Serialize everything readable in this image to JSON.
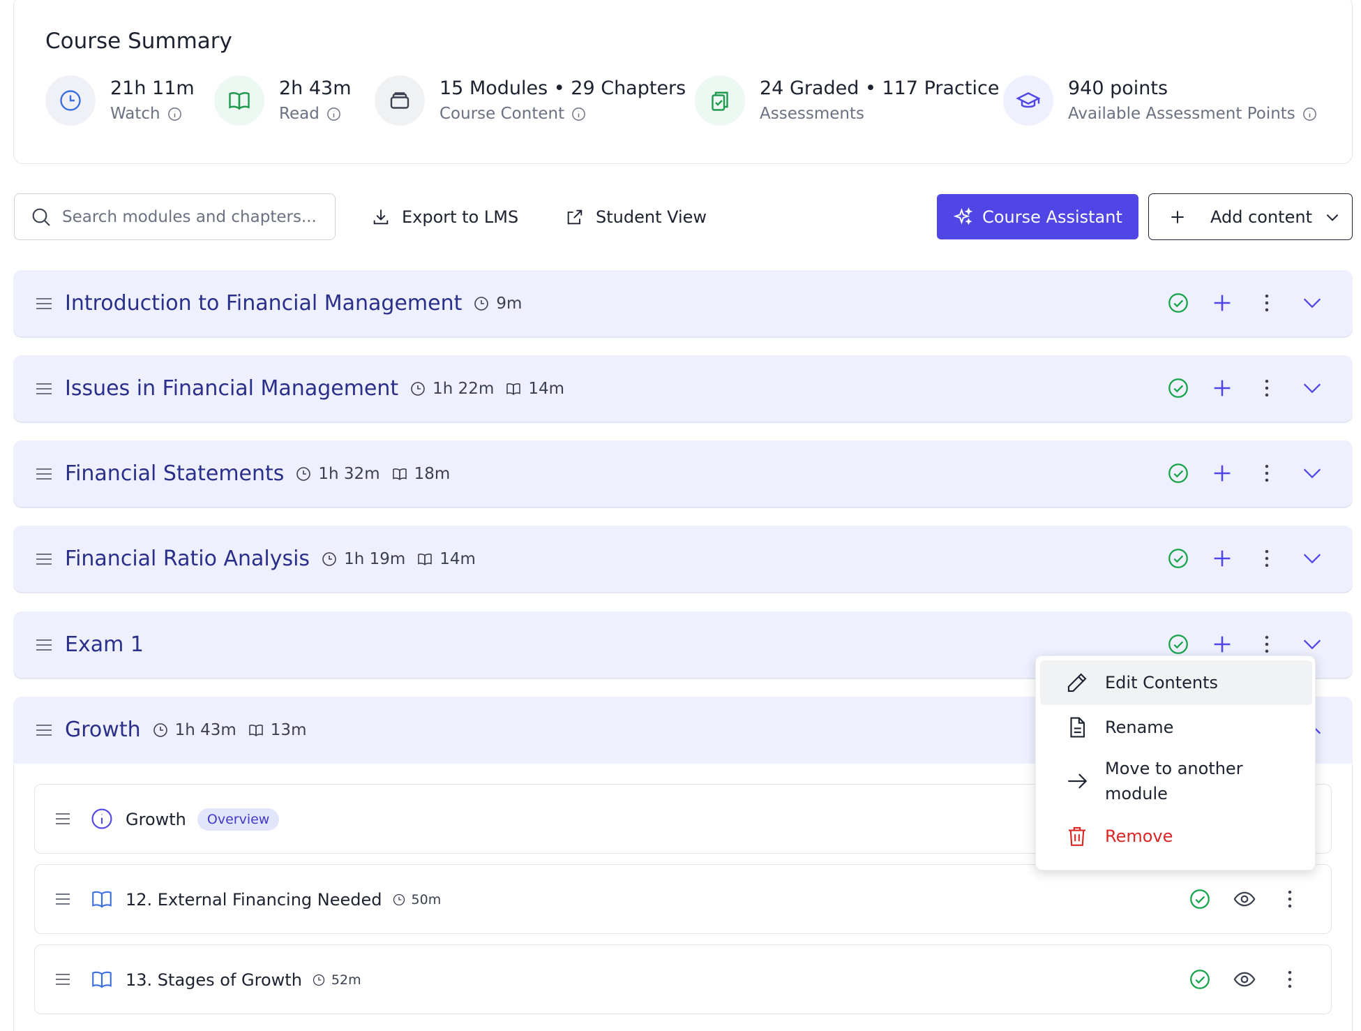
{
  "summary": {
    "title": "Course Summary",
    "stats": [
      {
        "value": "21h 11m",
        "label": "Watch",
        "icon": "clock-icon",
        "info": true
      },
      {
        "value": "2h 43m",
        "label": "Read",
        "icon": "book-icon",
        "info": true
      },
      {
        "value": "15 Modules • 29 Chapters",
        "label": "Course Content",
        "icon": "layers-icon",
        "info": true
      },
      {
        "value": "24 Graded • 117 Practice",
        "label": "Assessments",
        "icon": "clipboard-check-icon",
        "info": false
      },
      {
        "value": "940 points",
        "label": "Available Assessment Points",
        "icon": "graduation-cap-icon",
        "info": true
      }
    ]
  },
  "toolbar": {
    "search_placeholder": "Search modules and chapters...",
    "export_label": "Export to LMS",
    "student_view_label": "Student View",
    "assistant_label": "Course Assistant",
    "add_content_label": "Add content"
  },
  "modules": [
    {
      "title": "Introduction to Financial Management",
      "watch": "9m",
      "read": ""
    },
    {
      "title": "Issues in Financial Management",
      "watch": "1h 22m",
      "read": "14m"
    },
    {
      "title": "Financial Statements",
      "watch": "1h 32m",
      "read": "18m"
    },
    {
      "title": "Financial Ratio Analysis",
      "watch": "1h 19m",
      "read": "14m"
    },
    {
      "title": "Exam 1",
      "watch": "",
      "read": ""
    },
    {
      "title": "Growth",
      "watch": "1h 43m",
      "read": "13m"
    }
  ],
  "chapters": [
    {
      "title": "Growth",
      "badge": "Overview",
      "duration": ""
    },
    {
      "title": "12. External Financing Needed",
      "badge": "",
      "duration": "50m"
    },
    {
      "title": "13. Stages of Growth",
      "badge": "",
      "duration": "52m"
    }
  ],
  "menu": {
    "items": [
      {
        "label": "Edit Contents",
        "icon": "pencil-icon"
      },
      {
        "label": "Rename",
        "icon": "file-icon"
      },
      {
        "label": "Move to another module",
        "icon": "arrow-right-icon"
      },
      {
        "label": "Remove",
        "icon": "trash-icon"
      }
    ]
  },
  "colors": {
    "primary": "#4f46e5",
    "module_bg": "#eef0fd",
    "module_title": "#2a2f8a",
    "success": "#16a34a",
    "danger": "#dc2626"
  }
}
